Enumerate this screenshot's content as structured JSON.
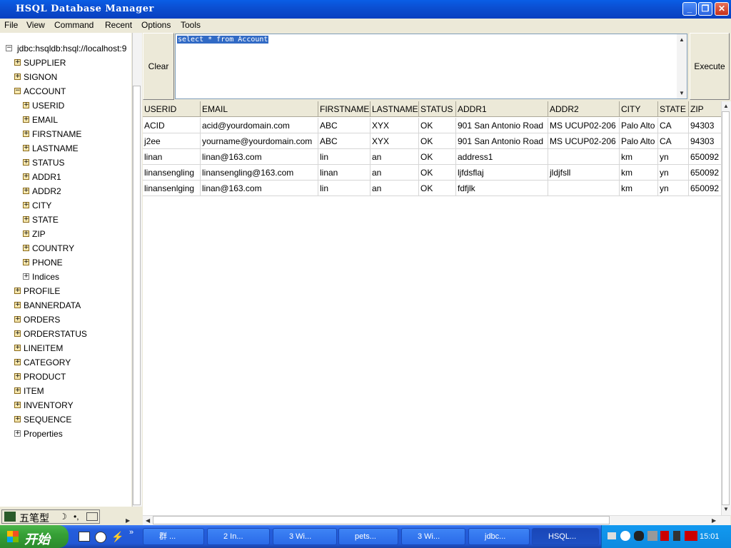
{
  "window": {
    "title": "HSQL Database Manager",
    "controls": [
      "minimize",
      "restore",
      "close"
    ]
  },
  "menu": [
    "File",
    "View",
    "Command",
    "Recent",
    "Options",
    "Tools"
  ],
  "tree": {
    "root": "jdbc:hsqldb:hsql://localhost:9",
    "tables_before": [
      "SUPPLIER",
      "SIGNON"
    ],
    "expanded_table": "ACCOUNT",
    "columns": [
      "USERID",
      "EMAIL",
      "FIRSTNAME",
      "LASTNAME",
      "STATUS",
      "ADDR1",
      "ADDR2",
      "CITY",
      "STATE",
      "ZIP",
      "COUNTRY",
      "PHONE"
    ],
    "indices": "Indices",
    "tables_after": [
      "PROFILE",
      "BANNERDATA",
      "ORDERS",
      "ORDERSTATUS",
      "LINEITEM",
      "CATEGORY",
      "PRODUCT",
      "ITEM",
      "INVENTORY",
      "SEQUENCE"
    ],
    "properties": "Properties"
  },
  "query": {
    "clear_label": "Clear",
    "text": "select * from Account",
    "execute_label": "Execute"
  },
  "results": {
    "columns": [
      "USERID",
      "EMAIL",
      "FIRSTNAME",
      "LASTNAME",
      "STATUS",
      "ADDR1",
      "ADDR2",
      "CITY",
      "STATE",
      "ZIP"
    ],
    "rows": [
      [
        "ACID",
        "acid@yourdomain.com",
        "ABC",
        "XYX",
        "OK",
        "901 San Antonio Road",
        "MS UCUP02-206",
        "Palo Alto",
        "CA",
        "94303"
      ],
      [
        "j2ee",
        "yourname@yourdomain.com",
        "ABC",
        "XYX",
        "OK",
        "901 San Antonio Road",
        "MS UCUP02-206",
        "Palo Alto",
        "CA",
        "94303"
      ],
      [
        "linan",
        "linan@163.com",
        "lin",
        "an",
        "OK",
        "address1",
        "",
        "km",
        "yn",
        "650092"
      ],
      [
        "linansengling",
        "linansengling@163.com",
        "linan",
        "an",
        "OK",
        "ljfdsflaj",
        "jldjfsll",
        "km",
        "yn",
        "650092"
      ],
      [
        "linansenlging",
        "linan@163.com",
        "lin",
        "an",
        "OK",
        "fdfjlk",
        "",
        "km",
        "yn",
        "650092"
      ]
    ]
  },
  "ime": {
    "label": "五笔型"
  },
  "taskbar": {
    "start_label": "开始",
    "tasks": [
      "群 ...",
      "2 In...",
      "3 Wi...",
      "pets...",
      "3 Wi...",
      "jdbc...",
      "HSQL..."
    ],
    "clock": "15:01"
  }
}
